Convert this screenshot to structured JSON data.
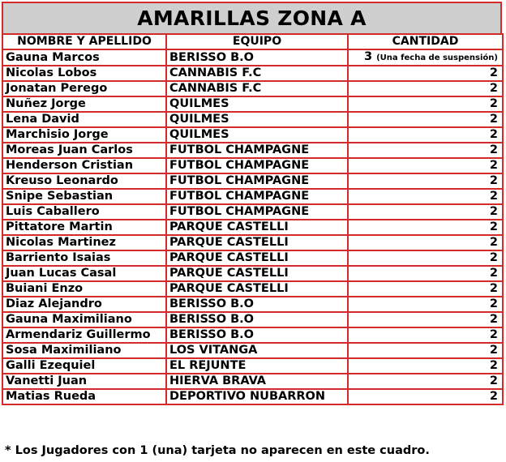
{
  "title": "AMARILLAS ZONA A",
  "headers": [
    "NOMBRE Y APELLIDO",
    "EQUIPO",
    "CANTIDAD"
  ],
  "rows": [
    {
      "name": "Gauna Marcos",
      "team": "BERISSO B.O",
      "qty": "3",
      "note": "(Una fecha de suspensión)"
    },
    {
      "name": "Nicolas Lobos",
      "team": "CANNABIS F.C",
      "qty": "2"
    },
    {
      "name": "Jonatan Perego",
      "team": "CANNABIS F.C",
      "qty": "2"
    },
    {
      "name": "Nuñez Jorge",
      "team": "QUILMES",
      "qty": "2"
    },
    {
      "name": "Lena David",
      "team": "QUILMES",
      "qty": "2"
    },
    {
      "name": "Marchisio Jorge",
      "team": "QUILMES",
      "qty": "2"
    },
    {
      "name": "Moreas Juan Carlos",
      "team": "FUTBOL CHAMPAGNE",
      "qty": "2"
    },
    {
      "name": "Henderson Cristian",
      "team": "FUTBOL CHAMPAGNE",
      "qty": "2"
    },
    {
      "name": "Kreuso Leonardo",
      "team": "FUTBOL CHAMPAGNE",
      "qty": "2"
    },
    {
      "name": "Snipe Sebastian",
      "team": "FUTBOL CHAMPAGNE",
      "qty": "2"
    },
    {
      "name": "Luis Caballero",
      "team": "FUTBOL CHAMPAGNE",
      "qty": "2"
    },
    {
      "name": "Pittatore Martin",
      "team": "PARQUE CASTELLI",
      "qty": "2"
    },
    {
      "name": "Nicolas Martinez",
      "team": "PARQUE CASTELLI",
      "qty": "2"
    },
    {
      "name": "Barriento Isaias",
      "team": "PARQUE CASTELLI",
      "qty": "2"
    },
    {
      "name": "Juan Lucas Casal",
      "team": "PARQUE CASTELLI",
      "qty": "2"
    },
    {
      "name": "Buiani Enzo",
      "team": "PARQUE CASTELLI",
      "qty": "2"
    },
    {
      "name": "Diaz Alejandro",
      "team": "BERISSO B.O",
      "qty": "2"
    },
    {
      "name": "Gauna Maximiliano",
      "team": "BERISSO B.O",
      "qty": "2"
    },
    {
      "name": "Armendariz Guillermo",
      "team": "BERISSO B.O",
      "qty": "2"
    },
    {
      "name": "Sosa Maximiliano",
      "team": "LOS VITANGA",
      "qty": "2"
    },
    {
      "name": "Galli Ezequiel",
      "team": "EL REJUNTE",
      "qty": "2"
    },
    {
      "name": "Vanetti Juan",
      "team": "HIERVA BRAVA",
      "qty": "2"
    },
    {
      "name": "Matias Rueda",
      "team": "DEPORTIVO NUBARRON",
      "qty": "2"
    }
  ],
  "footnote": "* Los Jugadores con 1 (una) tarjeta no aparecen en este cuadro.",
  "colors": {
    "border": "#d42a2a",
    "title_bg": "#cfcfcf"
  }
}
